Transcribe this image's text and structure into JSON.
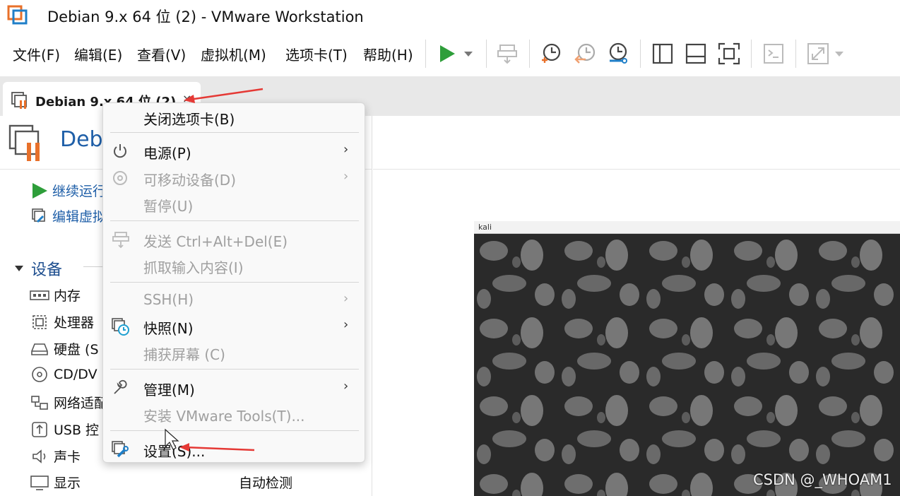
{
  "window": {
    "title": "Debian 9.x 64 位 (2) - VMware Workstation"
  },
  "menu": {
    "file": "文件(F)",
    "edit": "编辑(E)",
    "view": "查看(V)",
    "vm": "虚拟机(M)",
    "tabs": "选项卡(T)",
    "help": "帮助(H)"
  },
  "toolbar": {
    "icons": [
      "play-icon",
      "dropdown-icon",
      "send-keys-icon",
      "snapshot-take-icon",
      "snapshot-revert-icon",
      "snapshot-manager-icon",
      "library-view-icon",
      "thumbnail-view-icon",
      "fullscreen-icon",
      "console-icon",
      "unity-icon"
    ]
  },
  "tab": {
    "label": "Debian 9.x 64 位 (2)",
    "close": "×"
  },
  "vm_panel": {
    "heading": "Debi",
    "actions": [
      {
        "label": "继续运行",
        "icon": "play-icon"
      },
      {
        "label": "编辑虚拟",
        "icon": "edit-settings-icon"
      }
    ],
    "devices_title": "设备",
    "devices": [
      {
        "label": "内存",
        "icon": "memory-icon"
      },
      {
        "label": "处理器",
        "icon": "cpu-icon"
      },
      {
        "label": "硬盘 (S",
        "icon": "hdd-icon"
      },
      {
        "label": "CD/DV",
        "icon": "cdrom-icon"
      },
      {
        "label": "网络适配",
        "icon": "network-icon"
      },
      {
        "label": "USB 控",
        "icon": "usb-icon"
      },
      {
        "label": "声卡",
        "icon": "sound-icon"
      },
      {
        "label": "显示",
        "icon": "display-icon"
      }
    ],
    "display_value": "自动检测"
  },
  "vm_screen": {
    "bar_label": "kali"
  },
  "context_menu": {
    "items": [
      {
        "label": "关闭选项卡(B)",
        "enabled": true,
        "submenu": false,
        "icon": ""
      },
      {
        "label": "电源(P)",
        "enabled": true,
        "submenu": true,
        "icon": "power-icon"
      },
      {
        "label": "可移动设备(D)",
        "enabled": false,
        "submenu": true,
        "icon": "removable-device-icon"
      },
      {
        "label": "暂停(U)",
        "enabled": false,
        "submenu": false,
        "icon": ""
      },
      {
        "label": "发送 Ctrl+Alt+Del(E)",
        "enabled": false,
        "submenu": false,
        "icon": "send-keys-icon"
      },
      {
        "label": "抓取输入内容(I)",
        "enabled": false,
        "submenu": false,
        "icon": ""
      },
      {
        "label": "SSH(H)",
        "enabled": false,
        "submenu": true,
        "icon": ""
      },
      {
        "label": "快照(N)",
        "enabled": true,
        "submenu": true,
        "icon": "snapshot-icon"
      },
      {
        "label": "捕获屏幕 (C)",
        "enabled": false,
        "submenu": false,
        "icon": ""
      },
      {
        "label": "管理(M)",
        "enabled": true,
        "submenu": true,
        "icon": "wrench-icon"
      },
      {
        "label": "安装 VMware Tools(T)...",
        "enabled": false,
        "submenu": false,
        "icon": ""
      },
      {
        "label": "设置(S)...",
        "enabled": true,
        "submenu": false,
        "icon": "settings-icon"
      }
    ],
    "submenu_glyph": "›"
  },
  "watermark": "CSDN @_WHOAM1",
  "colors": {
    "accent_blue": "#1f5fa8",
    "play_green": "#2e9e3a",
    "vmware_orange": "#e8702a",
    "arrow_red": "#e53935"
  }
}
